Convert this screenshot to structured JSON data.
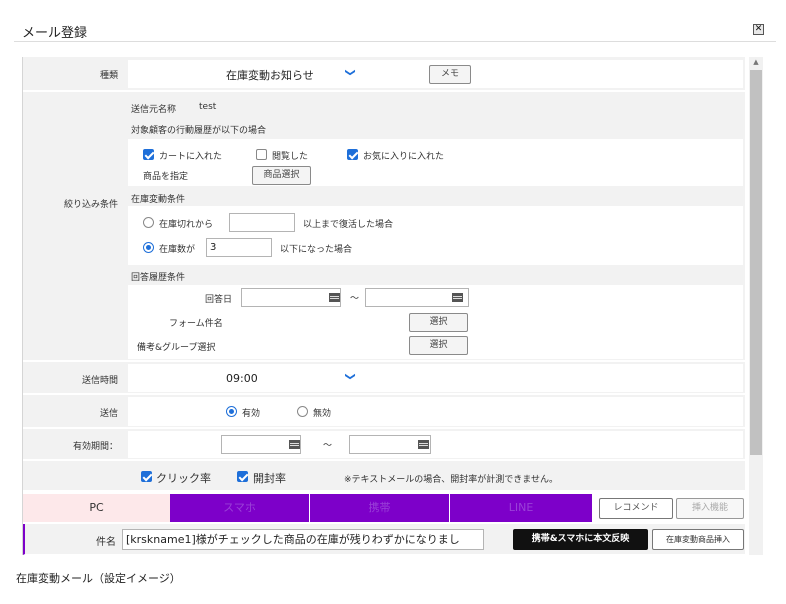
{
  "dialog": {
    "title": "メール登録",
    "close_label": "✕"
  },
  "rows": {
    "type": {
      "label": "種類",
      "select_value": "在庫変動お知らせ",
      "memo_button": "メモ"
    },
    "filter": {
      "label": "絞り込み条件",
      "sender_label": "送信元名称",
      "sender_value": "test",
      "behavior_heading": "対象顧客の行動履歴が以下の場合",
      "checkbox_cart": "カートに入れた",
      "checkbox_viewed": "閲覧した",
      "checkbox_favorite": "お気に入りに入れた",
      "product_label": "商品を指定",
      "product_button": "商品選択",
      "stock_heading": "在庫変動条件",
      "radio_restock_label": "在庫切れから",
      "radio_restock_suffix": "以上まで復活した場合",
      "radio_stock_label": "在庫数が",
      "radio_stock_value": "3",
      "radio_stock_suffix": "以下になった場合",
      "answer_heading": "回答履歴条件",
      "answer_date_label": "回答日",
      "answer_date_sep": "～",
      "form_name_label": "フォーム件名",
      "form_select_button": "選択",
      "note_group_label": "備考&グループ選択",
      "note_select_button": "選択"
    },
    "send_time": {
      "label": "送信時間",
      "value": "09:00"
    },
    "send": {
      "label": "送信",
      "radio_on": "有効",
      "radio_off": "無効"
    },
    "validity": {
      "label": "有効期間：",
      "sep": "～"
    },
    "tracking": {
      "checkbox_click": "クリック率",
      "checkbox_open": "開封率",
      "note": "※テキストメールの場合、開封率が計測できません。"
    },
    "tabs": {
      "pc": "PC",
      "t2": "スマホ",
      "t3": "携帯",
      "t4": "LINE",
      "recommend": "レコメンド",
      "insert_function": "挿入機能"
    },
    "subject": {
      "label": "件名",
      "value": "[krskname1]様がチェックした商品の在庫が残りわずかになりまし",
      "reflect_button": "携帯&スマホに本文反映",
      "insert_button": "在庫変動商品挿入"
    }
  },
  "caption": "在庫変動メール（設定イメージ）",
  "colors": {
    "accent_blue": "#1e6fd9",
    "tab_purple": "#7d00c9",
    "pc_tab_bg": "#fde8ea",
    "dark_button": "#111111"
  }
}
